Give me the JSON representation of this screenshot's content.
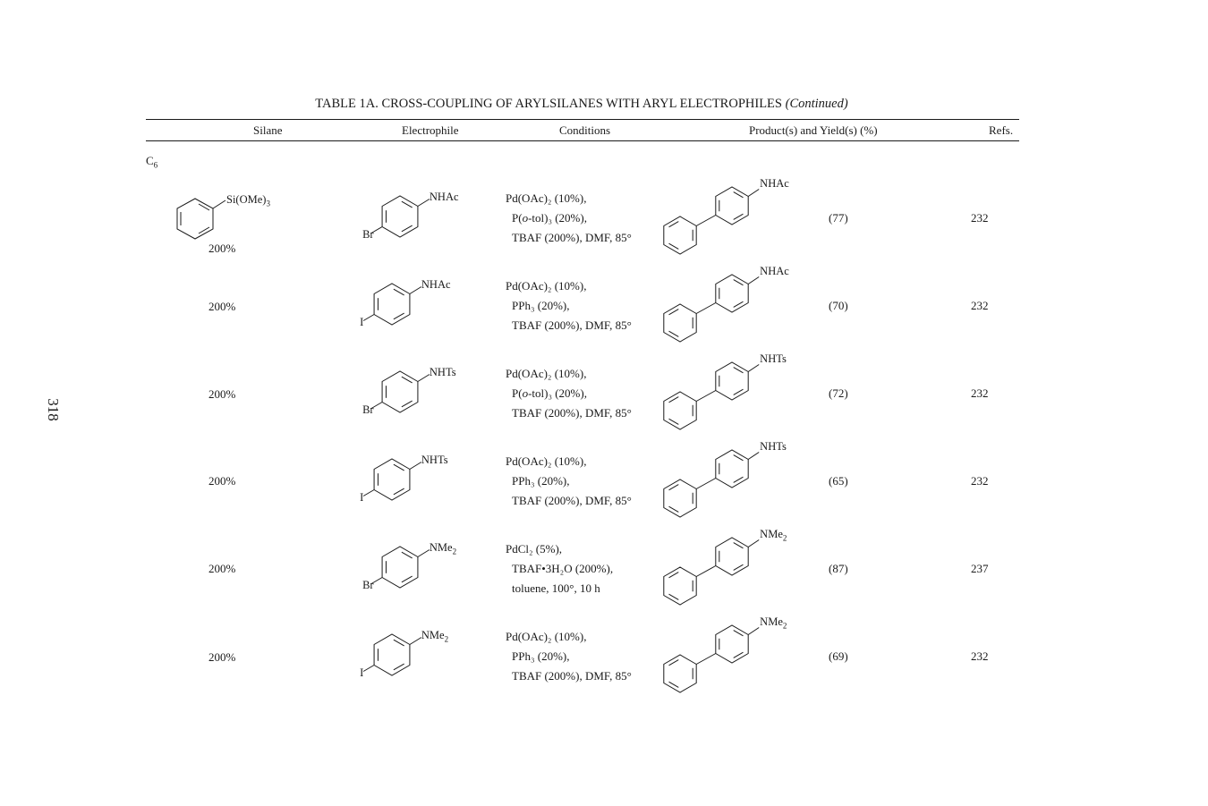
{
  "page_number": "318",
  "title": {
    "main": "TABLE 1A. CROSS-COUPLING OF ARYLSILANES WITH ARYL ELECTROPHILES",
    "continued": "(Continued)"
  },
  "headers": {
    "silane": "Silane",
    "electrophile": "Electrophile",
    "conditions": "Conditions",
    "products": "Product(s) and Yield(s) (%)",
    "refs": "Refs."
  },
  "section": {
    "label": "C",
    "sub": "6"
  },
  "silane_structure": {
    "substituent": "Si(OMe)",
    "sub": "3"
  },
  "rows": [
    {
      "silane_amount": "200%",
      "electrophile": {
        "halogen": "Br",
        "group": "NHAc",
        "group_sub": ""
      },
      "conditions": [
        "Pd(OAc)₂ (10%),",
        "P(o-tol)₃ (20%),",
        "TBAF (200%), DMF, 85°"
      ],
      "product_group": "NHAc",
      "product_sub": "",
      "yield": "(77)",
      "ref": "232"
    },
    {
      "silane_amount": "200%",
      "electrophile": {
        "halogen": "I",
        "group": "NHAc",
        "group_sub": ""
      },
      "conditions": [
        "Pd(OAc)₂ (10%),",
        "PPh₃ (20%),",
        "TBAF (200%), DMF, 85°"
      ],
      "product_group": "NHAc",
      "product_sub": "",
      "yield": "(70)",
      "ref": "232"
    },
    {
      "silane_amount": "200%",
      "electrophile": {
        "halogen": "Br",
        "group": "NHTs",
        "group_sub": ""
      },
      "conditions": [
        "Pd(OAc)₂ (10%),",
        "P(o-tol)₃ (20%),",
        "TBAF (200%), DMF, 85°"
      ],
      "product_group": "NHTs",
      "product_sub": "",
      "yield": "(72)",
      "ref": "232"
    },
    {
      "silane_amount": "200%",
      "electrophile": {
        "halogen": "I",
        "group": "NHTs",
        "group_sub": ""
      },
      "conditions": [
        "Pd(OAc)₂ (10%),",
        "PPh₃ (20%),",
        "TBAF (200%), DMF, 85°"
      ],
      "product_group": "NHTs",
      "product_sub": "",
      "yield": "(65)",
      "ref": "232"
    },
    {
      "silane_amount": "200%",
      "electrophile": {
        "halogen": "Br",
        "group": "NMe",
        "group_sub": "2"
      },
      "conditions": [
        "PdCl₂ (5%),",
        "TBAF•3H₂O (200%),",
        "toluene, 100°, 10 h"
      ],
      "product_group": "NMe",
      "product_sub": "2",
      "yield": "(87)",
      "ref": "237"
    },
    {
      "silane_amount": "200%",
      "electrophile": {
        "halogen": "I",
        "group": "NMe",
        "group_sub": "2"
      },
      "conditions": [
        "Pd(OAc)₂ (10%),",
        "PPh₃ (20%),",
        "TBAF (200%), DMF, 85°"
      ],
      "product_group": "NMe",
      "product_sub": "2",
      "yield": "(69)",
      "ref": "232"
    }
  ]
}
